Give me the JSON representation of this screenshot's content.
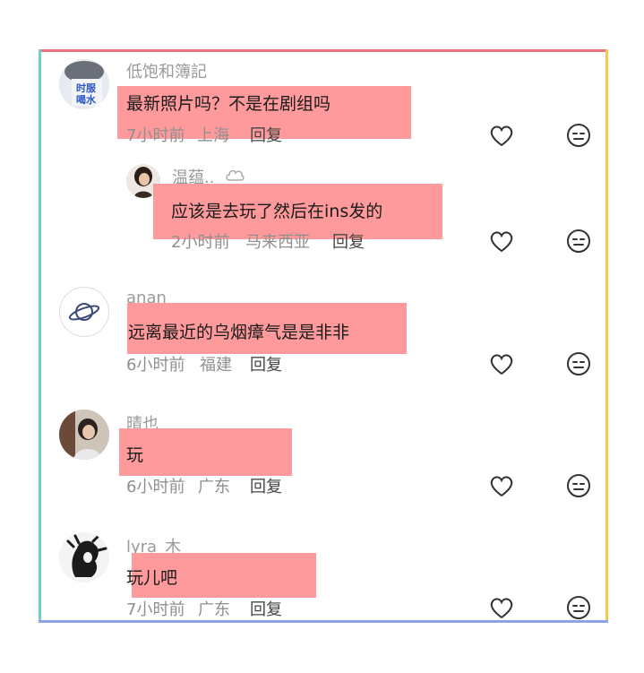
{
  "comments": [
    {
      "user": "低饱和簿記",
      "text": "最新照片吗？不是在剧组吗",
      "time": "7小时前",
      "location": "上海",
      "reply": "回复",
      "avatar_text": "时服\n喝水"
    },
    {
      "user": "温蕴..",
      "text": "应该是去玩了然后在ins发的",
      "time": "2小时前",
      "location": "马来西亚",
      "reply": "回复"
    },
    {
      "user": "anan",
      "text": "远离最近的乌烟瘴气是是非非",
      "time": "6小时前",
      "location": "福建",
      "reply": "回复"
    },
    {
      "user": "晴也",
      "text": "玩",
      "time": "6小时前",
      "location": "广东",
      "reply": "回复"
    },
    {
      "user": "lyra_木",
      "text": "玩儿吧",
      "time": "7小时前",
      "location": "广东",
      "reply": "回复"
    }
  ],
  "icons": {
    "like": "heart-icon",
    "dislike": "meh-face-icon"
  },
  "colors": {
    "highlight": "#ff9a9c",
    "frame_top": "#e8717e",
    "frame_left": "#6fcfcf",
    "frame_right": "#f2c94c",
    "frame_bottom": "#8aa3e6"
  }
}
